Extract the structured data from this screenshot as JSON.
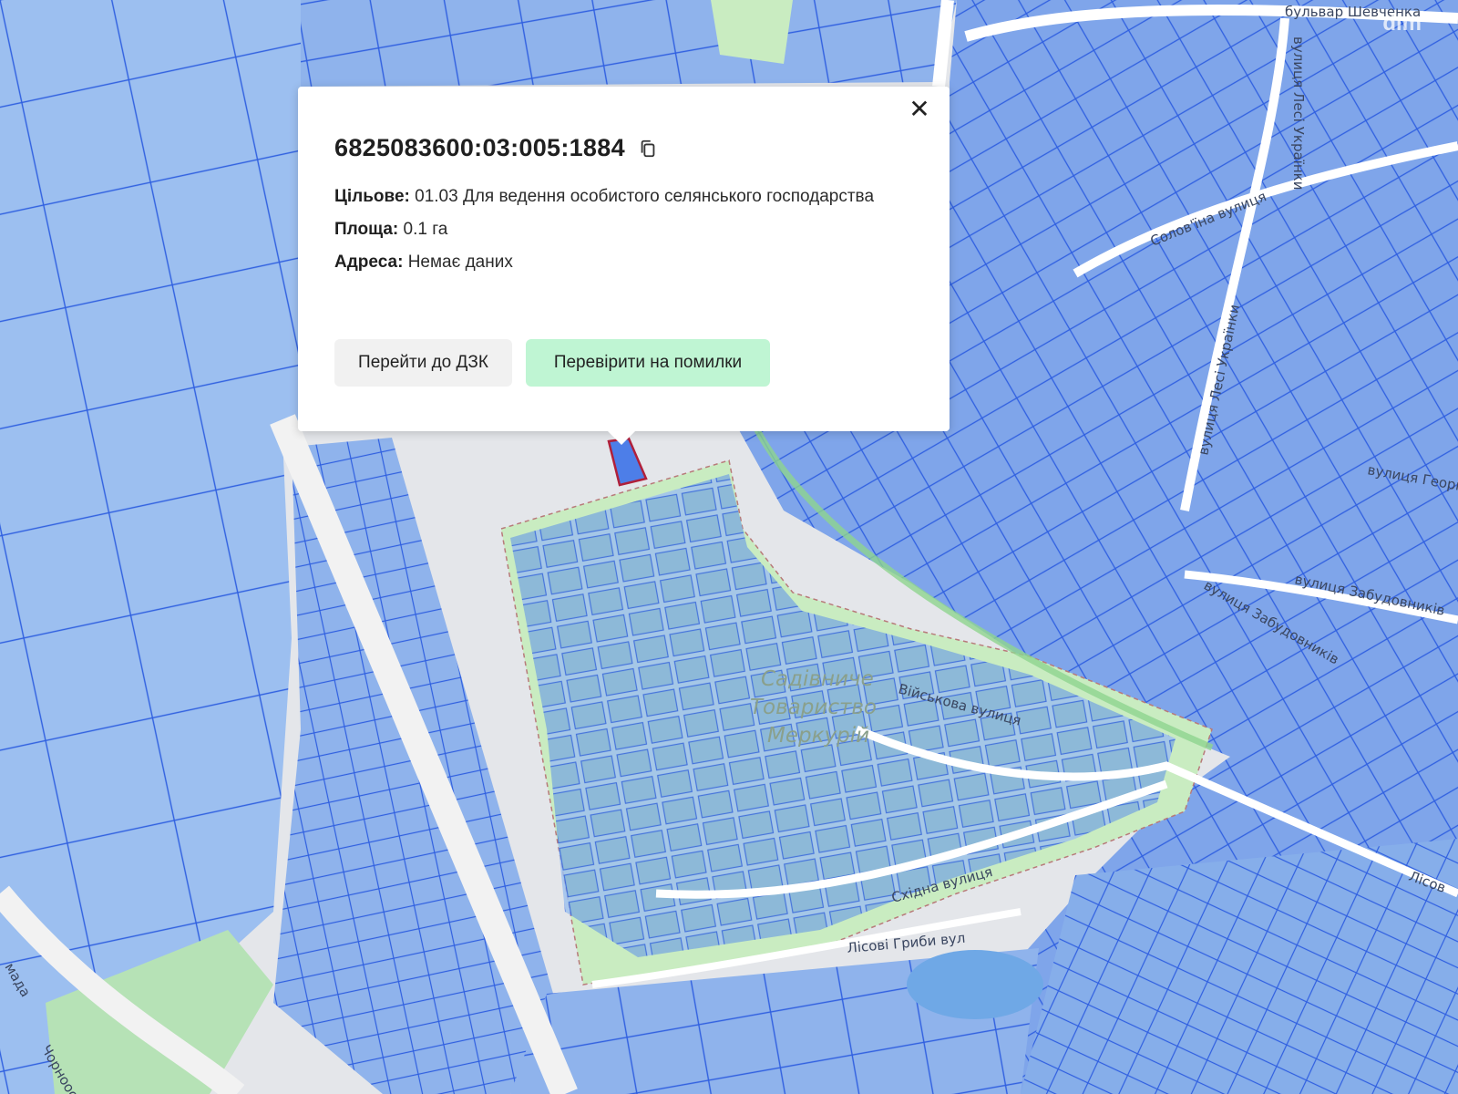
{
  "map": {
    "logo": "dim",
    "zone_label_lines": [
      "Садівниче",
      "Товариство",
      "Меркурій"
    ],
    "streets": [
      "бульвар Шевченка",
      "вулиця Лесі Українки",
      "Солов'їна вулиця",
      "вулиця Лесі Українки",
      "вулиця Георг",
      "вулиця Забудовників",
      "вулиця Забудовників",
      "Військова вулиця",
      "Східна вулиця",
      "Лісові Гриби вул",
      "Лісов",
      "мада",
      "Чорноостр"
    ],
    "colors": {
      "parcel_fill": "#8fb3ec",
      "parcel_stroke": "#2f5fe0",
      "green_zone": "#c9ecc1",
      "selected_parcel": "#b0203a",
      "water": "#6fa8e6"
    }
  },
  "popup": {
    "cadastral_number": "6825083600:03:005:1884",
    "purpose_label": "Цільове:",
    "purpose_value": "01.03 Для ведення особистого селянського господарства",
    "area_label": "Площа:",
    "area_value": "0.1 га",
    "address_label": "Адреса:",
    "address_value": "Немає даних",
    "btn_dzk": "Перейти до ДЗК",
    "btn_check": "Перевірити на помилки",
    "close_symbol": "✕"
  }
}
